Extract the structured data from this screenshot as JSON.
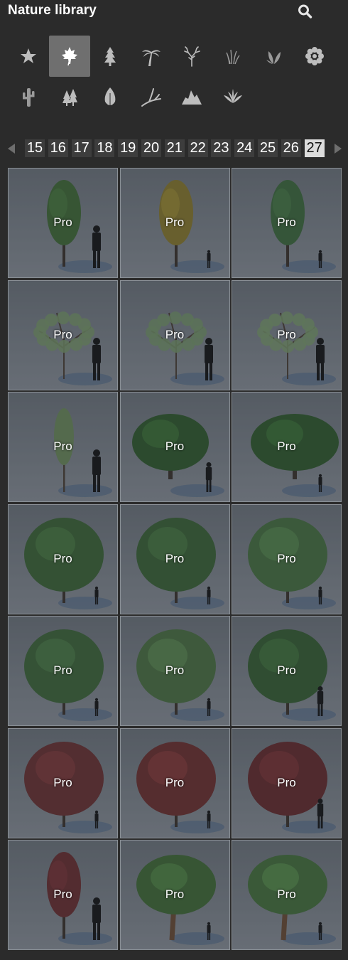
{
  "header": {
    "title": "Nature library",
    "search_icon": "search-icon"
  },
  "categories": [
    {
      "name": "favorites",
      "icon": "star-icon",
      "active": false
    },
    {
      "name": "deciduous-leaf",
      "icon": "maple-leaf-icon",
      "active": true
    },
    {
      "name": "conifer",
      "icon": "fir-tree-icon",
      "active": false
    },
    {
      "name": "palm",
      "icon": "palm-tree-icon",
      "active": false
    },
    {
      "name": "bare-tree",
      "icon": "bare-tree-icon",
      "active": false
    },
    {
      "name": "grass",
      "icon": "grass-icon",
      "active": false
    },
    {
      "name": "plants",
      "icon": "leafy-plant-icon",
      "active": false
    },
    {
      "name": "flowers",
      "icon": "flower-icon",
      "active": false
    },
    {
      "name": "cactus",
      "icon": "cactus-icon",
      "active": false
    },
    {
      "name": "forest",
      "icon": "pine-group-icon",
      "active": false
    },
    {
      "name": "leaf",
      "icon": "leaf-icon",
      "active": false
    },
    {
      "name": "branch",
      "icon": "branch-icon",
      "active": false
    },
    {
      "name": "rocks",
      "icon": "rocks-icon",
      "active": false
    },
    {
      "name": "fern",
      "icon": "fern-icon",
      "active": false
    }
  ],
  "pagination": {
    "pages": [
      "15",
      "16",
      "17",
      "18",
      "19",
      "20",
      "21",
      "22",
      "23",
      "24",
      "25",
      "26",
      "27"
    ],
    "current": "27",
    "prev_icon": "chevron-left-icon",
    "next_icon": "chevron-right-icon"
  },
  "items": [
    {
      "label": "Pro",
      "tree": "slender",
      "foliage": "#3f6a34",
      "person": "large"
    },
    {
      "label": "Pro",
      "tree": "slender",
      "foliage": "#8a7a2a",
      "person": "small"
    },
    {
      "label": "Pro",
      "tree": "slender",
      "foliage": "#3d6b3b",
      "person": "small"
    },
    {
      "label": "Pro",
      "tree": "sparse",
      "foliage": "#7a9a6a",
      "person": "large"
    },
    {
      "label": "Pro",
      "tree": "sparse",
      "foliage": "#77986a",
      "person": "large"
    },
    {
      "label": "Pro",
      "tree": "sparse",
      "foliage": "#7d9c6d",
      "person": "large"
    },
    {
      "label": "Pro",
      "tree": "thin",
      "foliage": "#6c8a5a",
      "person": "large"
    },
    {
      "label": "Pro",
      "tree": "wide",
      "foliage": "#2f5a2a",
      "person": "medium"
    },
    {
      "label": "Pro",
      "tree": "bushy",
      "foliage": "#2e5a2a",
      "person": "small"
    },
    {
      "label": "Pro",
      "tree": "round",
      "foliage": "#3b6534",
      "person": "small"
    },
    {
      "label": "Pro",
      "tree": "round",
      "foliage": "#3a6334",
      "person": "small"
    },
    {
      "label": "Pro",
      "tree": "round",
      "foliage": "#46703e",
      "person": "small"
    },
    {
      "label": "Pro",
      "tree": "round",
      "foliage": "#3d6637",
      "person": "small"
    },
    {
      "label": "Pro",
      "tree": "round",
      "foliage": "#4b7140",
      "person": "small"
    },
    {
      "label": "Pro",
      "tree": "round",
      "foliage": "#355f30",
      "person": "medium"
    },
    {
      "label": "Pro",
      "tree": "round",
      "foliage": "#6a2e2e",
      "person": "small"
    },
    {
      "label": "Pro",
      "tree": "round",
      "foliage": "#6e2d2c",
      "person": "small"
    },
    {
      "label": "Pro",
      "tree": "round",
      "foliage": "#66282a",
      "person": "medium"
    },
    {
      "label": "Pro",
      "tree": "slender",
      "foliage": "#6a2b2d",
      "person": "large"
    },
    {
      "label": "Pro",
      "tree": "gnarled",
      "foliage": "#3f6a34",
      "person": "small"
    },
    {
      "label": "Pro",
      "tree": "gnarled",
      "foliage": "#44703a",
      "person": "small"
    }
  ]
}
